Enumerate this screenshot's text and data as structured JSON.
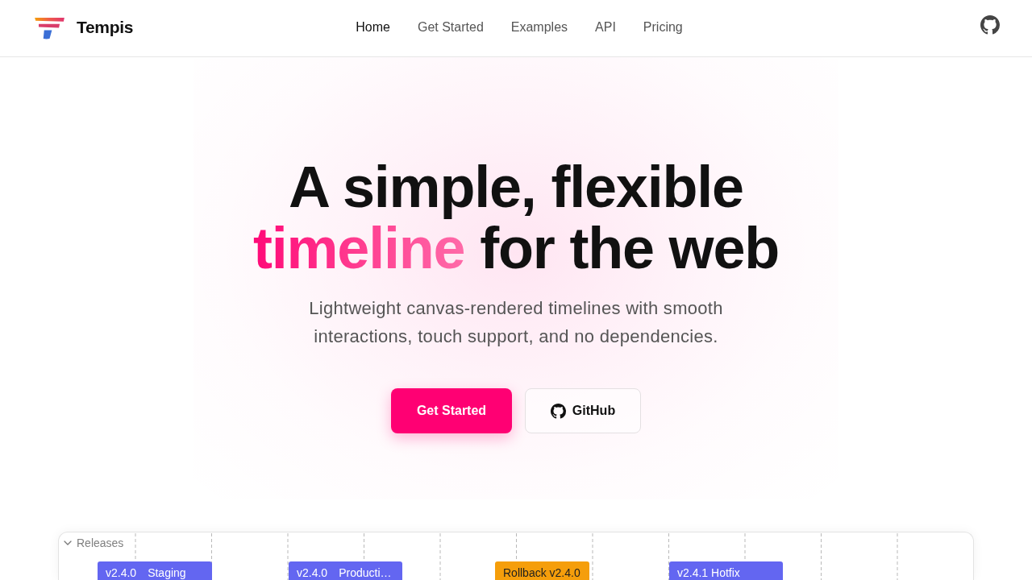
{
  "header": {
    "brand": "Tempis",
    "nav": [
      {
        "label": "Home",
        "selected": true
      },
      {
        "label": "Get Started",
        "selected": false
      },
      {
        "label": "Examples",
        "selected": false
      },
      {
        "label": "API",
        "selected": false
      },
      {
        "label": "Pricing",
        "selected": false
      }
    ]
  },
  "hero": {
    "title_line_1": "A simple, flexible",
    "title_highlight": "timeline",
    "title_rest": "for the web",
    "subtitle": "Lightweight canvas-rendered timelines with smooth interactions, touch support, and no dependencies.",
    "buttons": [
      {
        "label": "Get Started",
        "kind": "primary"
      },
      {
        "label": "GitHub",
        "kind": "secondary"
      }
    ]
  },
  "timeline": {
    "groups": [
      {
        "label": "Releases",
        "expanded": true,
        "items": [
          {
            "version": "v2.4.0",
            "label": "Staging",
            "color": "#6366f1"
          },
          {
            "version": "v2.4.0",
            "label": "Producti…",
            "color": "#6366f1"
          },
          {
            "label": "Rollback v2.4.0",
            "color": "#f59e0b"
          },
          {
            "label": "v2.4.1 Hotfix",
            "color": "#6366f1"
          }
        ]
      }
    ]
  }
}
